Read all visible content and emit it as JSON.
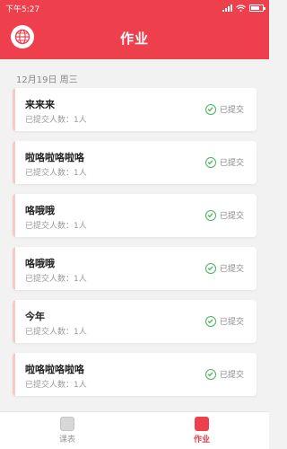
{
  "status_bar": {
    "time": "下午5:27",
    "battery_level": 0.75
  },
  "header": {
    "title": "作业"
  },
  "list": {
    "date": "12月19日 周三",
    "items": [
      {
        "title": "来来来",
        "submitted": "已提交人数：1人",
        "status": "已提交"
      },
      {
        "title": "啦咯啦咯啦咯",
        "submitted": "已提交人数：1人",
        "status": "已提交"
      },
      {
        "title": "咯哦哦",
        "submitted": "已提交人数：1人",
        "status": "已提交"
      },
      {
        "title": "咯哦哦",
        "submitted": "已提交人数：1人",
        "status": "已提交"
      },
      {
        "title": "今年",
        "submitted": "已提交人数：1人",
        "status": "已提交"
      },
      {
        "title": "啦咯啦咯啦咯",
        "submitted": "已提交人数：1人",
        "status": "已提交"
      }
    ]
  },
  "tabbar": {
    "tabs": [
      {
        "label": "课表",
        "icon": "timetable-icon",
        "active": false
      },
      {
        "label": "作业",
        "icon": "homework-icon",
        "active": true
      }
    ]
  },
  "colors": {
    "primary": "#ee3f4d",
    "success": "#47b35a"
  }
}
